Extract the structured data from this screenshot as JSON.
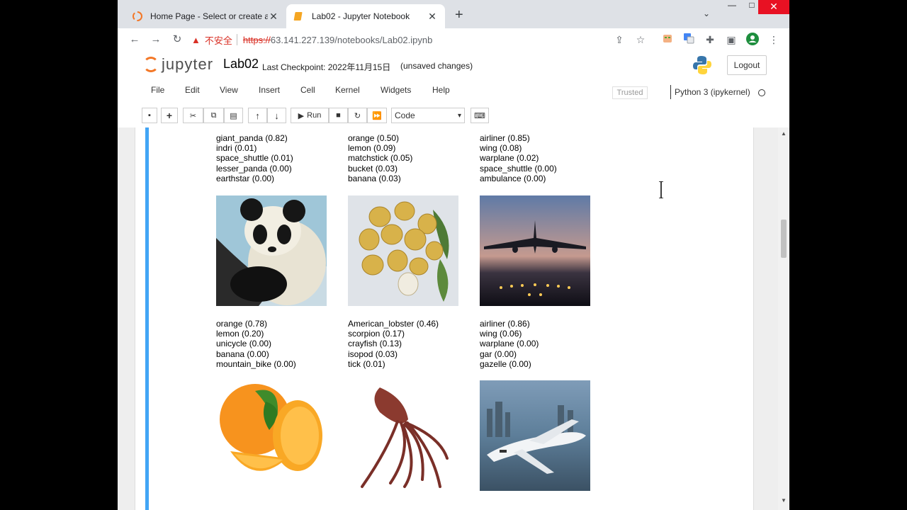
{
  "tabs": [
    {
      "label": "Home Page - Select or create a",
      "active": false
    },
    {
      "label": "Lab02 - Jupyter Notebook",
      "active": true
    }
  ],
  "address": {
    "not_secure": "不安全",
    "url_scheme": "https://",
    "url_rest": "63.141.227.139/notebooks/Lab02.ipynb"
  },
  "jupyter": {
    "logo_text": "jupyter",
    "notebook_name": "Lab02",
    "checkpoint": "Last Checkpoint: 2022年11月15日",
    "unsaved": "(unsaved changes)",
    "logout": "Logout",
    "menu": [
      "File",
      "Edit",
      "View",
      "Insert",
      "Cell",
      "Kernel",
      "Widgets",
      "Help"
    ],
    "trusted": "Trusted",
    "kernel": "Python 3 (ipykernel)",
    "run_label": "Run",
    "cell_type": "Code"
  },
  "predictions": [
    {
      "lines": [
        "giant_panda (0.82)",
        "indri (0.01)",
        "space_shuttle (0.01)",
        "lesser_panda (0.00)",
        "earthstar (0.00)"
      ]
    },
    {
      "lines": [
        "orange (0.50)",
        "lemon (0.09)",
        "matchstick (0.05)",
        "bucket (0.03)",
        "banana (0.03)"
      ]
    },
    {
      "lines": [
        "airliner (0.85)",
        "wing (0.08)",
        "warplane (0.02)",
        "space_shuttle (0.00)",
        "ambulance (0.00)"
      ]
    },
    {
      "lines": [
        "orange (0.78)",
        "lemon (0.20)",
        "unicycle (0.00)",
        "banana (0.00)",
        "mountain_bike (0.00)"
      ]
    },
    {
      "lines": [
        "American_lobster (0.46)",
        "scorpion (0.17)",
        "crayfish (0.13)",
        "isopod (0.03)",
        "tick (0.01)"
      ]
    },
    {
      "lines": [
        "airliner (0.86)",
        "wing (0.06)",
        "warplane (0.00)",
        "gar (0.00)",
        "gazelle (0.00)"
      ]
    }
  ],
  "images": [
    "panda-photo",
    "lemons-photo",
    "airliner-landing-photo",
    "orange-photo",
    "squid-photo",
    "jet-over-city-photo"
  ],
  "colors": {
    "accent": "#42a5f5",
    "jupyter_orange": "#f37726",
    "close_red": "#e81123"
  }
}
